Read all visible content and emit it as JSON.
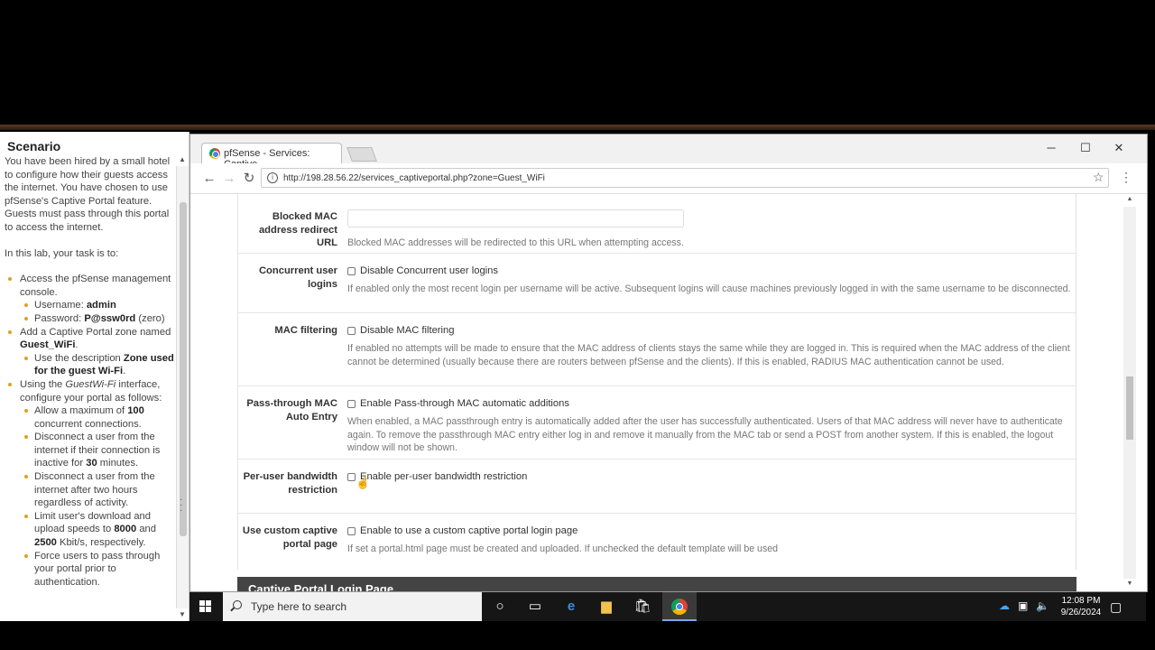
{
  "scenario": {
    "title": "Scenario",
    "intro": "You have been hired by a small hotel to configure how their guests access the internet. You have chosen to use pfSense's Captive Portal feature. Guests must pass through this portal to access the internet.",
    "task_intro": "In this lab, your task is to:",
    "items": [
      {
        "text": "Access the pfSense management console."
      },
      {
        "sub_label": "Username: ",
        "sub_value": "admin"
      },
      {
        "sub_label": "Password: ",
        "sub_value": "P@ssw0rd",
        "sub_note": " (zero)"
      },
      {
        "pre": "Add a Captive Portal zone named ",
        "bold": "Guest_WiFi",
        "post": "."
      },
      {
        "pre": "Use the description ",
        "bold": "Zone used for the guest Wi-Fi",
        "post": "."
      },
      {
        "pre": "Using the ",
        "italic": "GuestWi-Fi",
        "post": " interface, configure your portal as follows:"
      },
      {
        "pre": "Allow a maximum of ",
        "bold": "100",
        "post": " concurrent connections."
      },
      {
        "pre": "Disconnect a user from the internet if their connection is inactive for ",
        "bold": "30",
        "post": " minutes."
      },
      {
        "text": "Disconnect a user from the internet after two hours regardless of activity."
      },
      {
        "pre": "Limit user's download and upload speeds to ",
        "bold": "8000",
        "mid": " and ",
        "bold2": "2500",
        "post": " Kbit/s, respectively."
      },
      {
        "text": "Force users to pass through your portal prior to authentication."
      }
    ]
  },
  "browser": {
    "tab_title": "pfSense - Services: Captive ...",
    "url": "http://198.28.56.22/services_captiveportal.php?zone=Guest_WiFi"
  },
  "form": {
    "blocked_mac": {
      "label": "Blocked MAC address redirect URL",
      "help": "Blocked MAC addresses will be redirected to this URL when attempting access."
    },
    "concurrent": {
      "label": "Concurrent user logins",
      "check": "Disable Concurrent user logins",
      "help": "If enabled only the most recent login per username will be active. Subsequent logins will cause machines previously logged in with the same username to be disconnected."
    },
    "mac_filter": {
      "label": "MAC filtering",
      "check": "Disable MAC filtering",
      "help": "If enabled no attempts will be made to ensure that the MAC address of clients stays the same while they are logged in. This is required when the MAC address of the client cannot be determined (usually because there are routers between pfSense and the clients). If this is enabled, RADIUS MAC authentication cannot be used."
    },
    "passthrough": {
      "label": "Pass-through MAC Auto Entry",
      "check": "Enable Pass-through MAC automatic additions",
      "help": "When enabled, a MAC passthrough entry is automatically added after the user has successfully authenticated. Users of that MAC address will never have to authenticate again. To remove the passthrough MAC entry either log in and remove it manually from the MAC tab or send a POST from another system. If this is enabled, the logout window will not be shown."
    },
    "bandwidth": {
      "label": "Per-user bandwidth restriction",
      "check": "Enable per-user bandwidth restriction"
    },
    "custom_page": {
      "label": "Use custom captive portal page",
      "check": "Enable to use a custom captive portal login page",
      "help": "If set a portal.html page must be created and uploaded. If unchecked the default template will be used"
    },
    "section_title": "Captive Portal Login Page"
  },
  "taskbar": {
    "search_placeholder": "Type here to search",
    "time": "12:08 PM",
    "date": "9/26/2024"
  }
}
